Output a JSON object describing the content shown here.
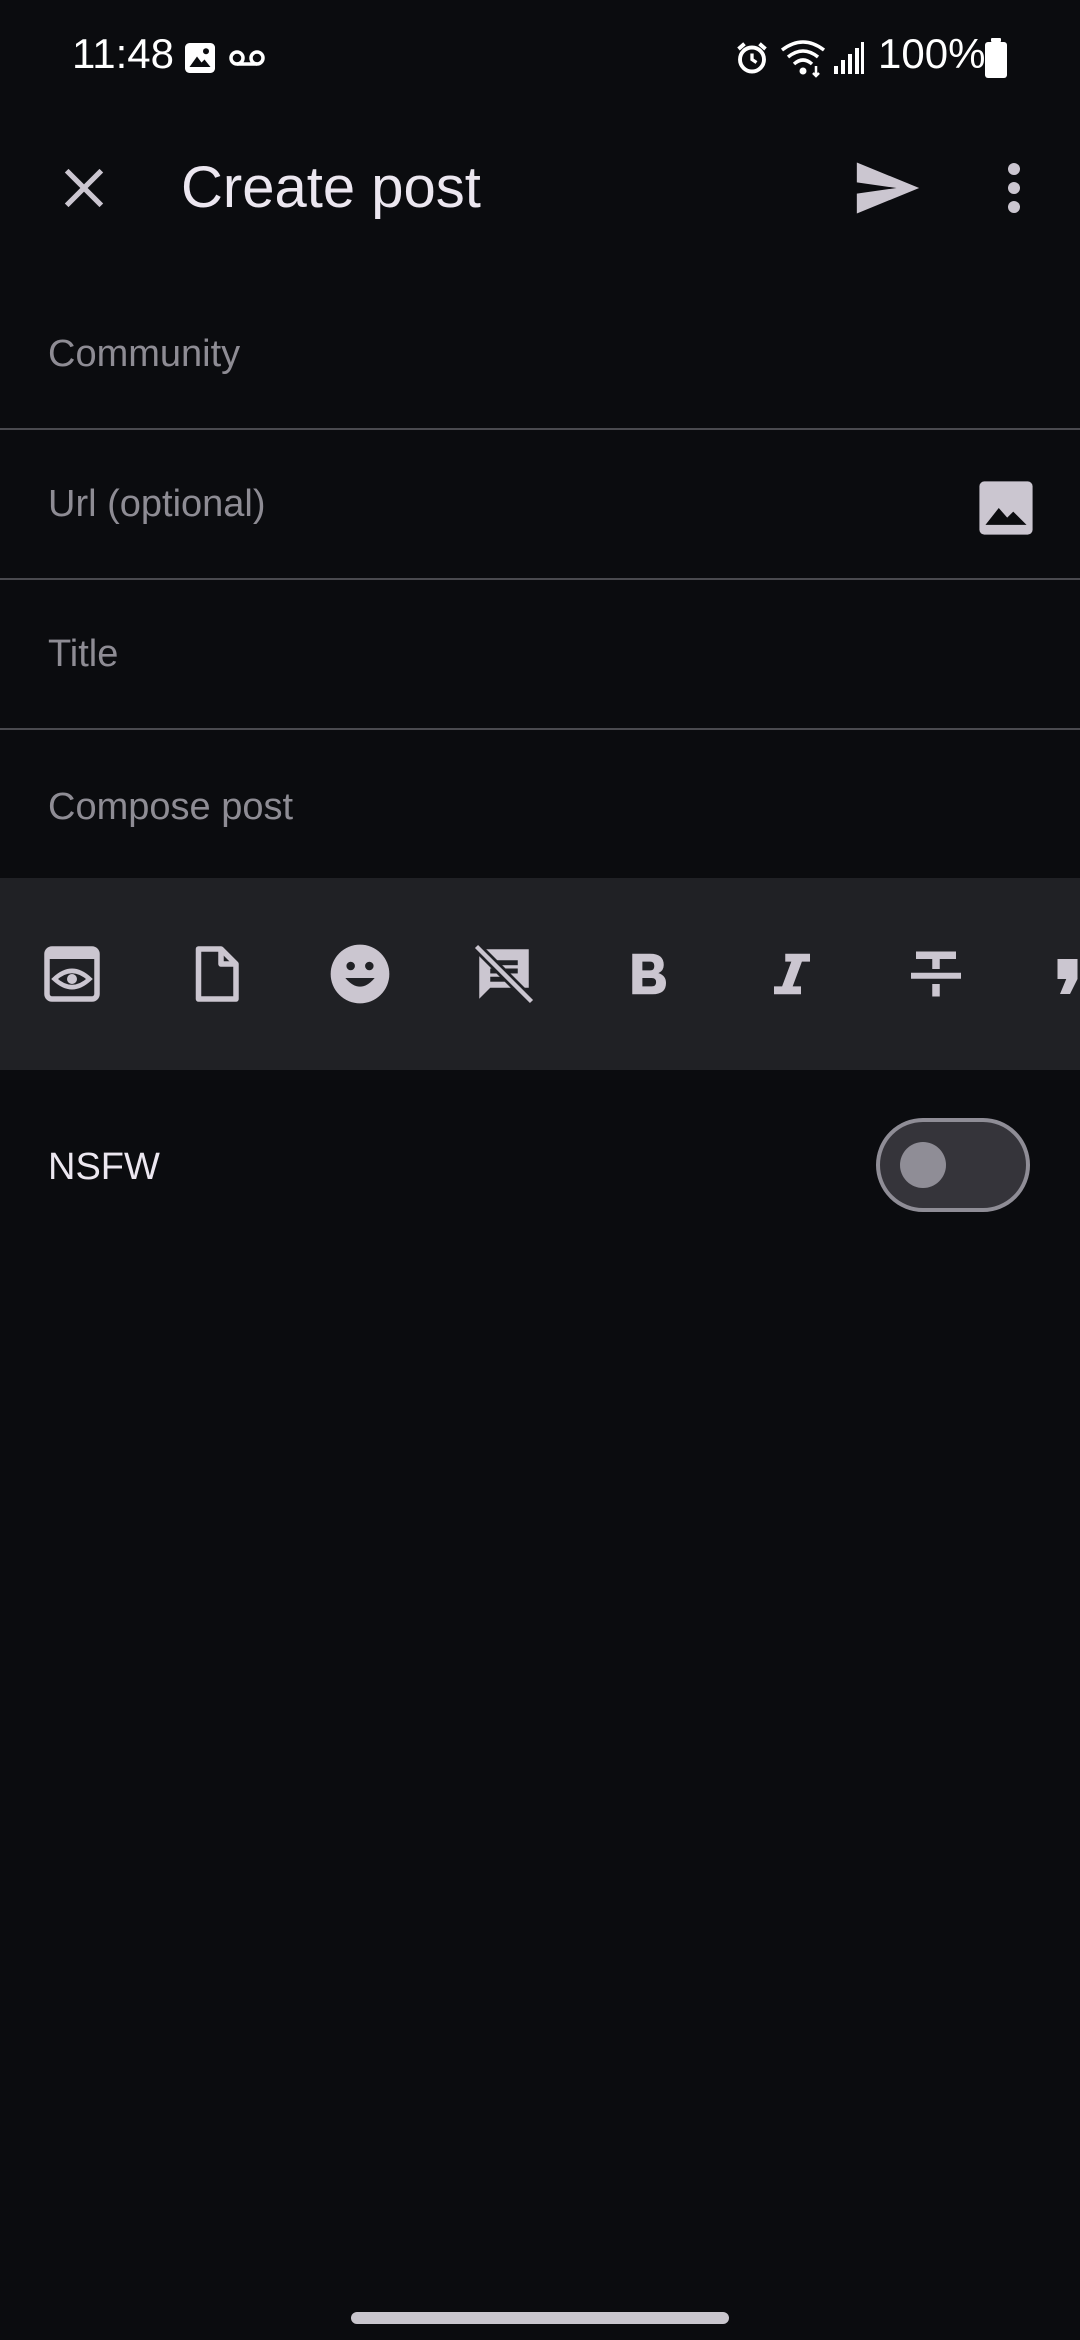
{
  "status_bar": {
    "time": "11:48",
    "battery": "100%",
    "icons": [
      "image-icon",
      "voicemail-icon",
      "alarm-icon",
      "wifi-icon",
      "signal-icon",
      "battery-icon"
    ]
  },
  "app_bar": {
    "title": "Create post",
    "close_icon": "close-icon",
    "send_icon": "send-icon",
    "more_icon": "more-vert-icon"
  },
  "form": {
    "community_placeholder": "Community",
    "url_placeholder": "Url (optional)",
    "title_placeholder": "Title",
    "compose_placeholder": "Compose post"
  },
  "toolbar": {
    "icons": [
      "preview-icon",
      "file-icon",
      "emoji-icon",
      "comments-disabled-icon",
      "bold-icon",
      "italic-icon",
      "strikethrough-icon",
      "quote-icon"
    ]
  },
  "nsfw": {
    "label": "NSFW",
    "enabled": false
  },
  "colors": {
    "background": "#0b0c0f",
    "toolbar_background": "#202125",
    "icon": "#cbc6d0",
    "placeholder": "#8e8c94"
  }
}
